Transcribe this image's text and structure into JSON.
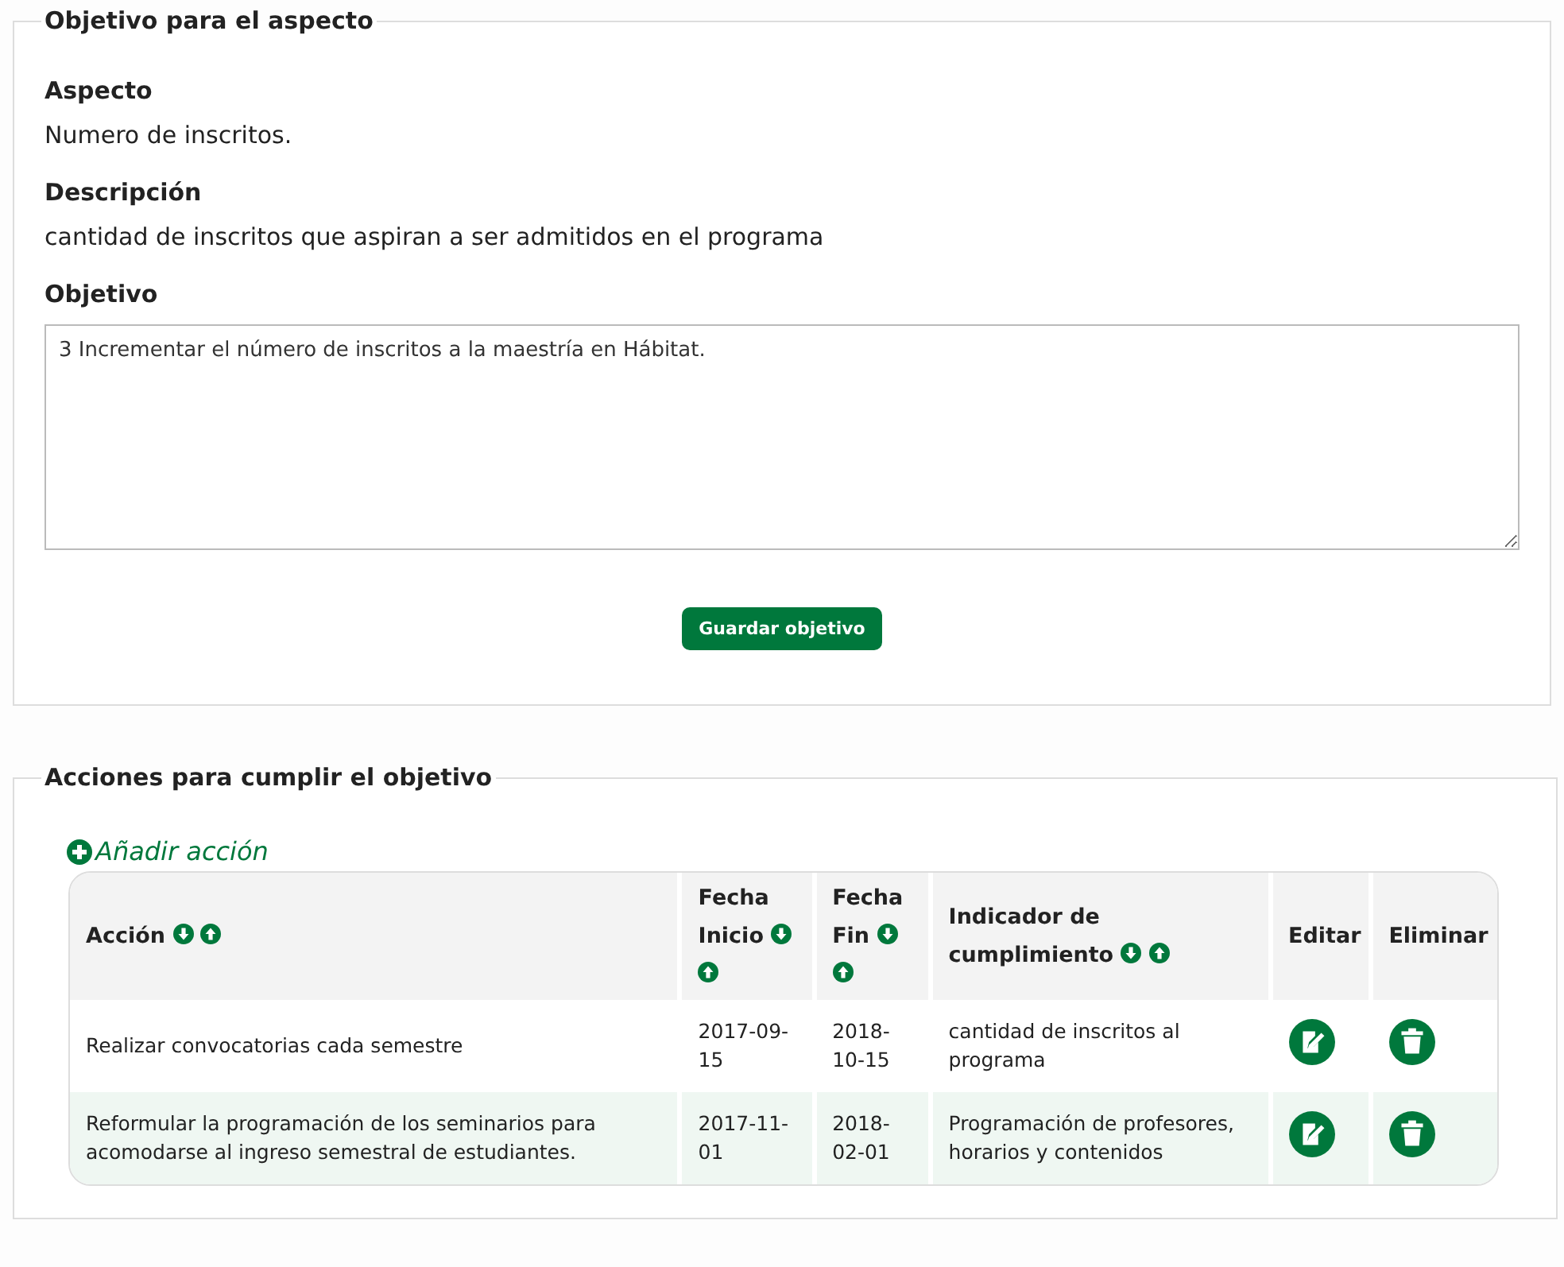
{
  "objective_section": {
    "legend": "Objetivo para el aspecto",
    "fields": [
      {
        "label": "Aspecto",
        "value": "Numero de inscritos."
      },
      {
        "label": "Descripción",
        "value": "cantidad de inscritos que aspiran a ser admitidos en el programa"
      }
    ],
    "objective": {
      "label": "Objetivo",
      "value": "3 Incrementar el número de inscritos a la maestría en Hábitat."
    },
    "save_button": "Guardar objetivo"
  },
  "actions_section": {
    "legend": "Acciones para cumplir el objetivo",
    "add_link": "Añadir acción",
    "table": {
      "columns": [
        {
          "label": "Acción",
          "sortable": true
        },
        {
          "label": "Fecha Inicio",
          "sortable": true
        },
        {
          "label": "Fecha Fin",
          "sortable": true
        },
        {
          "label": "Indicador de cumplimiento",
          "sortable": true
        },
        {
          "label": "Editar",
          "sortable": false
        },
        {
          "label": "Eliminar",
          "sortable": false
        }
      ],
      "rows": [
        {
          "action": "Realizar convocatorias cada semestre",
          "start": "2017-09-15",
          "end": "2018-10-15",
          "indicator": "cantidad de inscritos al programa"
        },
        {
          "action": "Reformular la programación de los seminarios para acomodarse al ingreso semestral de estudiantes.",
          "start": "2017-11-01",
          "end": "2018-02-01",
          "indicator": "Programación de profesores, horarios y contenidos"
        }
      ]
    }
  }
}
